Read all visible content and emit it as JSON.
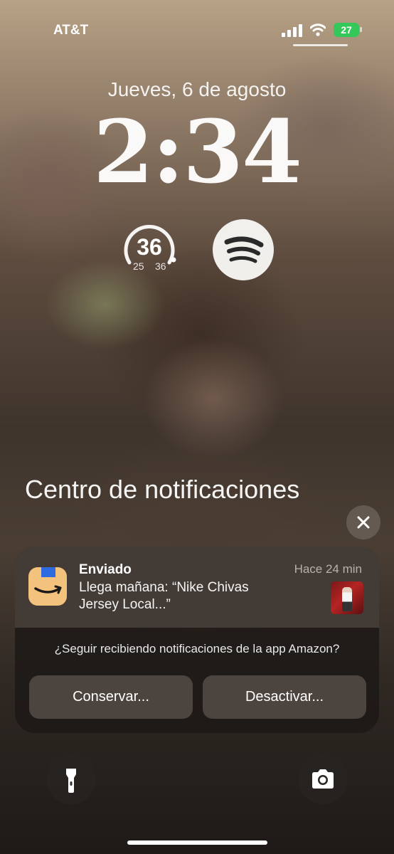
{
  "status": {
    "carrier": "AT&T",
    "battery": "27"
  },
  "lockscreen": {
    "date": "Jueves, 6 de agosto",
    "time": "2:34"
  },
  "widgets": {
    "temperature": {
      "current": "36",
      "low": "25",
      "high": "36"
    }
  },
  "notification_center": {
    "title": "Centro de notificaciones"
  },
  "notification": {
    "app_icon": "amazon-icon",
    "title": "Enviado",
    "time": "Hace 24 min",
    "body": "Llega mañana: “Nike Chivas Jersey Local...”",
    "question": "¿Seguir recibiendo notificaciones de la app Amazon?",
    "keep_label": "Conservar...",
    "disable_label": "Desactivar..."
  },
  "icons": [
    "signal-icon",
    "wifi-icon",
    "battery-icon",
    "spotify-icon",
    "close-icon",
    "flashlight-icon",
    "camera-icon"
  ],
  "colors": {
    "battery": "#34c759",
    "spotify_bars": "#2a2a2a",
    "amazon_icon": "#f3c37e"
  }
}
